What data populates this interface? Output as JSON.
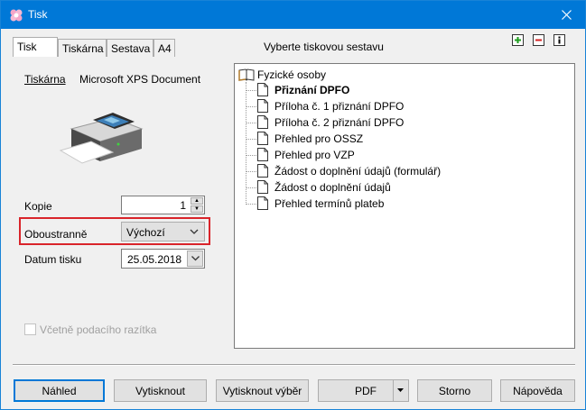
{
  "window": {
    "title": "Tisk",
    "app_icon": "flower-icon",
    "close_icon": "close-icon"
  },
  "tabs": [
    {
      "label": "Tisk",
      "active": true
    },
    {
      "label": "Tiskárna",
      "active": false
    },
    {
      "label": "Sestava",
      "active": false
    },
    {
      "label": "A4",
      "active": false
    }
  ],
  "left": {
    "printer_label": "Tiskárna",
    "printer_name": "Microsoft XPS Document",
    "printer_icon": "printer-icon",
    "copies_label": "Kopie",
    "copies_value": "1",
    "duplex_label": "Oboustranně",
    "duplex_value": "Výchozí",
    "date_label": "Datum tisku",
    "date_value": "25.05.2018",
    "stamp_checkbox_label": "Včetně podacího razítka",
    "stamp_checked": false
  },
  "right": {
    "heading": "Vyberte tiskovou sestavu",
    "tools": [
      "add-icon",
      "remove-icon",
      "info-icon"
    ],
    "tree_root": "Fyzické osoby",
    "tree_items": [
      {
        "label": "Přiznání DPFO",
        "selected": true
      },
      {
        "label": "Příloha č. 1 přiznání DPFO",
        "selected": false
      },
      {
        "label": "Příloha č. 2 přiznání DPFO",
        "selected": false
      },
      {
        "label": "Přehled pro OSSZ",
        "selected": false
      },
      {
        "label": "Přehled pro VZP",
        "selected": false
      },
      {
        "label": "Žádost o doplnění údajů (formulář)",
        "selected": false
      },
      {
        "label": "Žádost o doplnění údajů",
        "selected": false
      },
      {
        "label": "Přehled termínů plateb",
        "selected": false
      }
    ]
  },
  "buttons": {
    "preview": "Náhled",
    "print": "Vytisknout",
    "print_selection": "Vytisknout výběr",
    "pdf": "PDF",
    "cancel": "Storno",
    "help": "Nápověda"
  },
  "colors": {
    "titlebar": "#0078d7",
    "highlight_box": "#d9242a",
    "default_button_border": "#0078d7"
  }
}
